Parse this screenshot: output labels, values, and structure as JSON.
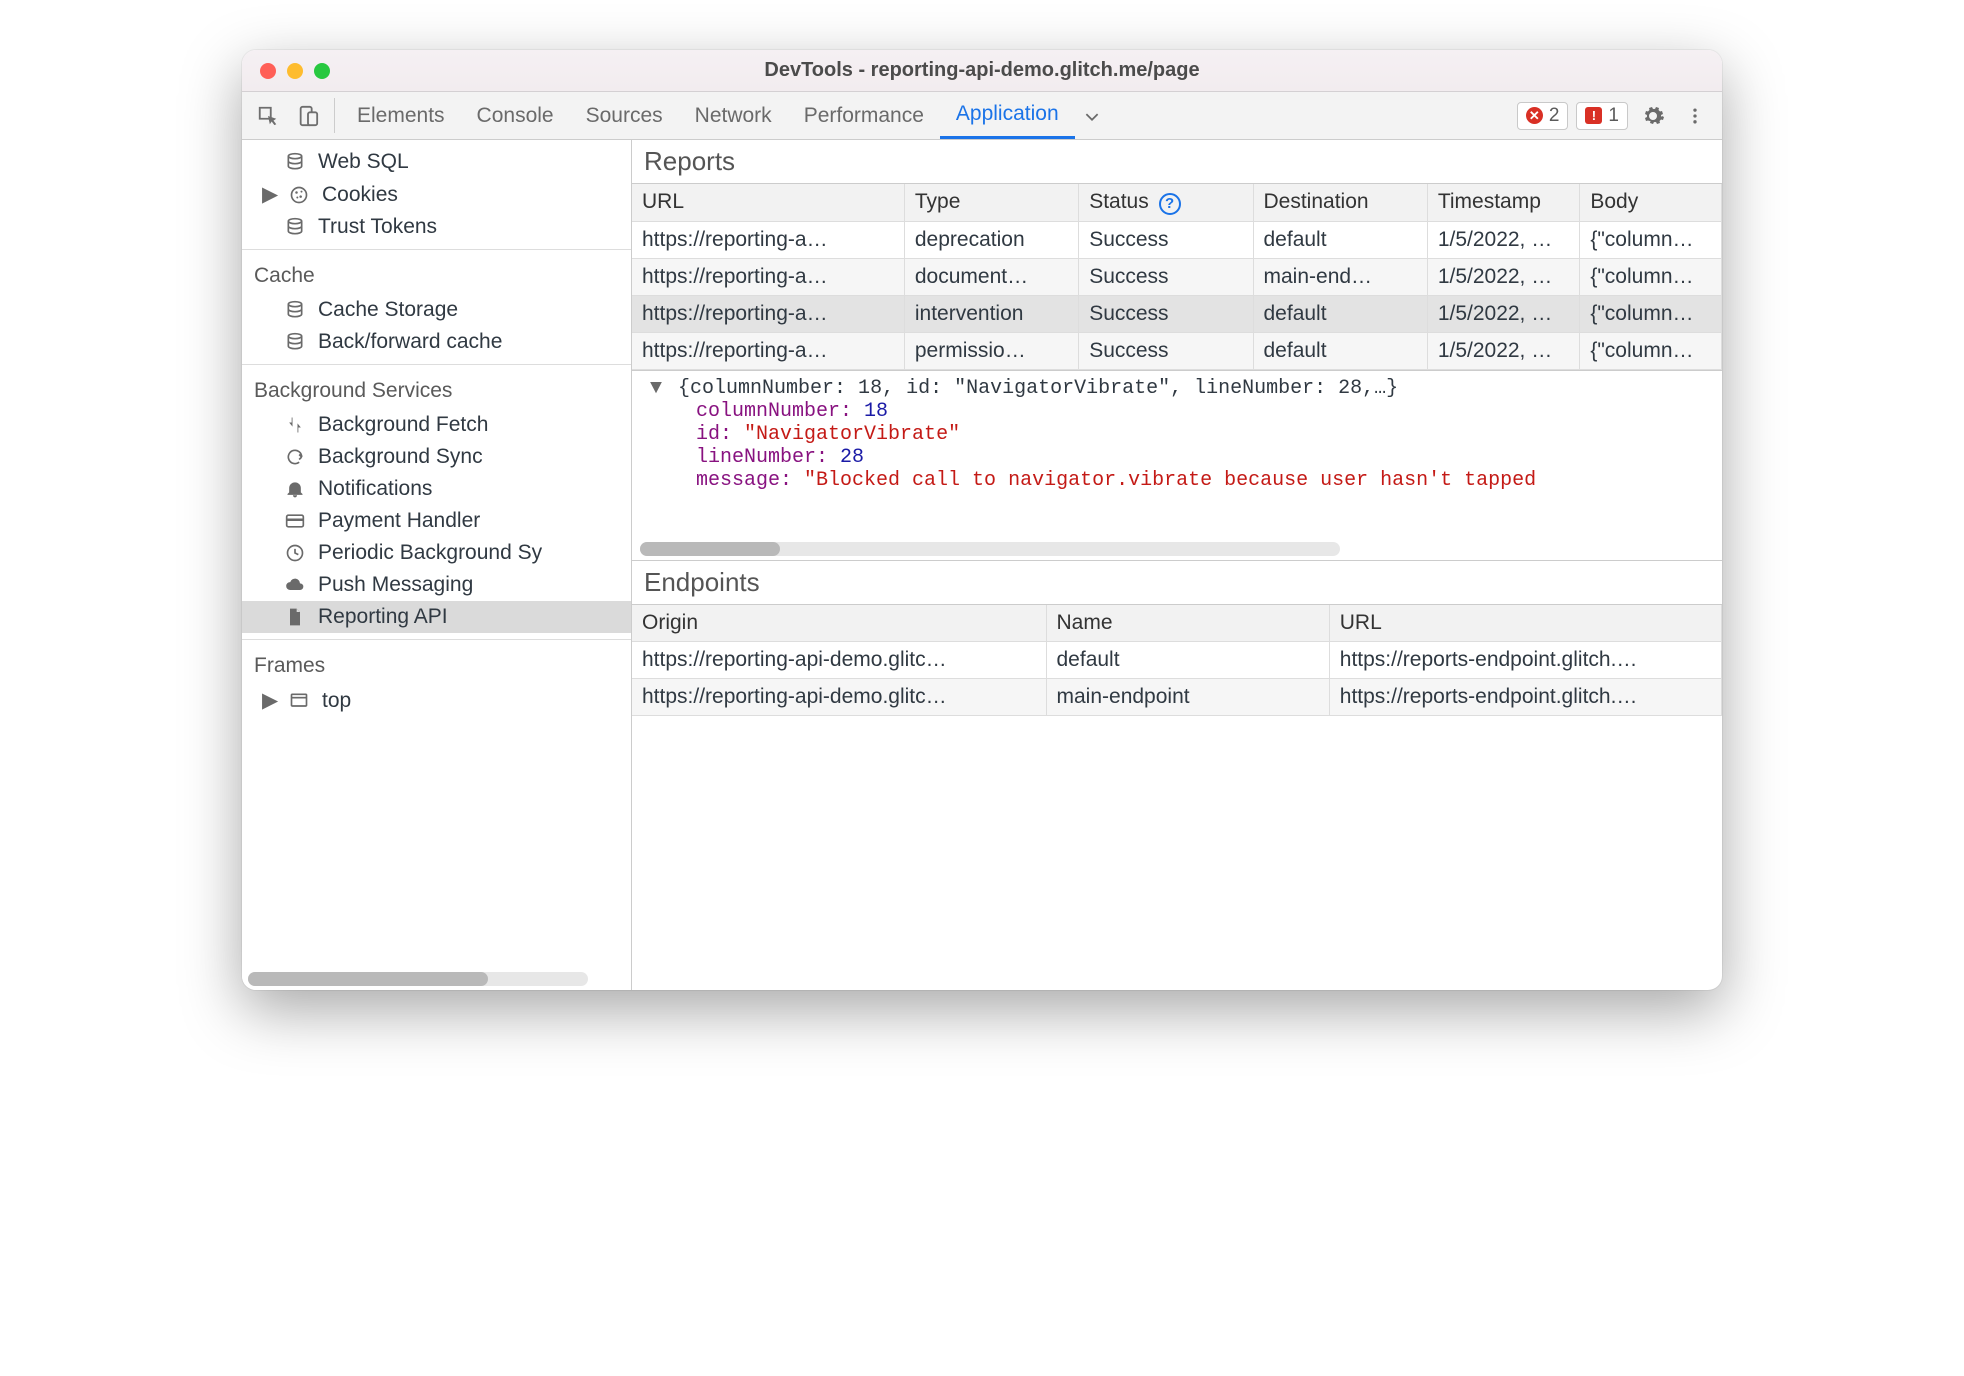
{
  "window": {
    "title": "DevTools - reporting-api-demo.glitch.me/page"
  },
  "toolbar": {
    "tabs": [
      "Elements",
      "Console",
      "Sources",
      "Network",
      "Performance",
      "Application"
    ],
    "active_tab_index": 5,
    "errors_count": "2",
    "issues_count": "1"
  },
  "sidebar": {
    "storage": {
      "items": [
        {
          "label": "Web SQL",
          "icon": "database-icon"
        },
        {
          "label": "Cookies",
          "icon": "cookie-icon",
          "has_caret": true
        },
        {
          "label": "Trust Tokens",
          "icon": "database-icon"
        }
      ]
    },
    "cache": {
      "title": "Cache",
      "items": [
        {
          "label": "Cache Storage",
          "icon": "database-icon"
        },
        {
          "label": "Back/forward cache",
          "icon": "database-icon"
        }
      ]
    },
    "background": {
      "title": "Background Services",
      "items": [
        {
          "label": "Background Fetch",
          "icon": "fetch-icon"
        },
        {
          "label": "Background Sync",
          "icon": "sync-icon"
        },
        {
          "label": "Notifications",
          "icon": "bell-icon"
        },
        {
          "label": "Payment Handler",
          "icon": "card-icon"
        },
        {
          "label": "Periodic Background Sy",
          "icon": "clock-icon"
        },
        {
          "label": "Push Messaging",
          "icon": "cloud-icon"
        },
        {
          "label": "Reporting API",
          "icon": "file-icon",
          "selected": true
        }
      ]
    },
    "frames": {
      "title": "Frames",
      "items": [
        {
          "label": "top",
          "icon": "frame-icon",
          "has_caret": true
        }
      ]
    }
  },
  "reports": {
    "title": "Reports",
    "columns": [
      "URL",
      "Type",
      "Status",
      "Destination",
      "Timestamp",
      "Body"
    ],
    "status_help_index": 2,
    "rows": [
      {
        "url": "https://reporting-a…",
        "type": "deprecation",
        "status": "Success",
        "destination": "default",
        "timestamp": "1/5/2022, …",
        "body": "{\"column…"
      },
      {
        "url": "https://reporting-a…",
        "type": "document…",
        "status": "Success",
        "destination": "main-end…",
        "timestamp": "1/5/2022, …",
        "body": "{\"column…"
      },
      {
        "url": "https://reporting-a…",
        "type": "intervention",
        "status": "Success",
        "destination": "default",
        "timestamp": "1/5/2022, …",
        "body": "{\"column…",
        "selected": true
      },
      {
        "url": "https://reporting-a…",
        "type": "permissio…",
        "status": "Success",
        "destination": "default",
        "timestamp": "1/5/2022, …",
        "body": "{\"column…"
      }
    ]
  },
  "detail": {
    "summary": "{columnNumber: 18, id: \"NavigatorVibrate\", lineNumber: 28,…}",
    "columnNumber_key": "columnNumber:",
    "columnNumber_val": "18",
    "id_key": "id:",
    "id_val": "\"NavigatorVibrate\"",
    "lineNumber_key": "lineNumber:",
    "lineNumber_val": "28",
    "message_key": "message:",
    "message_val": "\"Blocked call to navigator.vibrate because user hasn't tapped"
  },
  "endpoints": {
    "title": "Endpoints",
    "columns": [
      "Origin",
      "Name",
      "URL"
    ],
    "rows": [
      {
        "origin": "https://reporting-api-demo.glitc…",
        "name": "default",
        "url": "https://reports-endpoint.glitch.…"
      },
      {
        "origin": "https://reporting-api-demo.glitc…",
        "name": "main-endpoint",
        "url": "https://reports-endpoint.glitch.…"
      }
    ]
  }
}
